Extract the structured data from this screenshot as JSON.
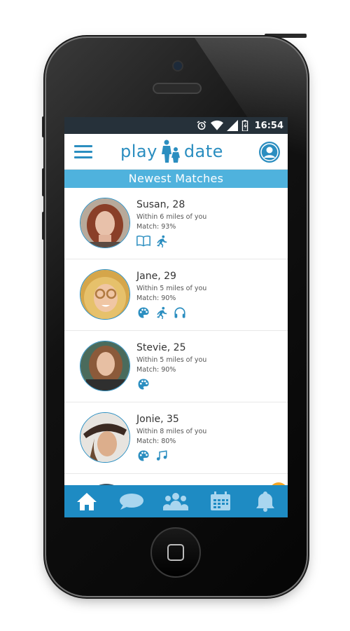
{
  "status_bar": {
    "time": "16:54"
  },
  "header": {
    "logo_left": "play",
    "logo_right": "date"
  },
  "section": {
    "title": "Newest Matches"
  },
  "matches": [
    {
      "name": "Susan, 28",
      "distance": "Within 6 miles of you",
      "match": "Match: 93%",
      "interests": [
        "book-icon",
        "running-icon"
      ]
    },
    {
      "name": "Jane, 29",
      "distance": "Within 5 miles of you",
      "match": "Match: 90%",
      "interests": [
        "palette-icon",
        "running-icon",
        "headphones-icon"
      ]
    },
    {
      "name": "Stevie, 25",
      "distance": "Within 5 miles of you",
      "match": "Match: 90%",
      "interests": [
        "palette-icon"
      ]
    },
    {
      "name": "Jonie, 35",
      "distance": "Within 8 miles of you",
      "match": "Match: 80%",
      "interests": [
        "palette-icon",
        "music-note-icon"
      ]
    }
  ],
  "bottom_nav": [
    "home-icon",
    "chat-icon",
    "group-icon",
    "calendar-icon",
    "bell-icon"
  ],
  "colors": {
    "primary": "#2b8ec0",
    "header_band": "#4fb2dd",
    "nav_bar": "#1e8bc3",
    "accent": "#f5a623"
  }
}
